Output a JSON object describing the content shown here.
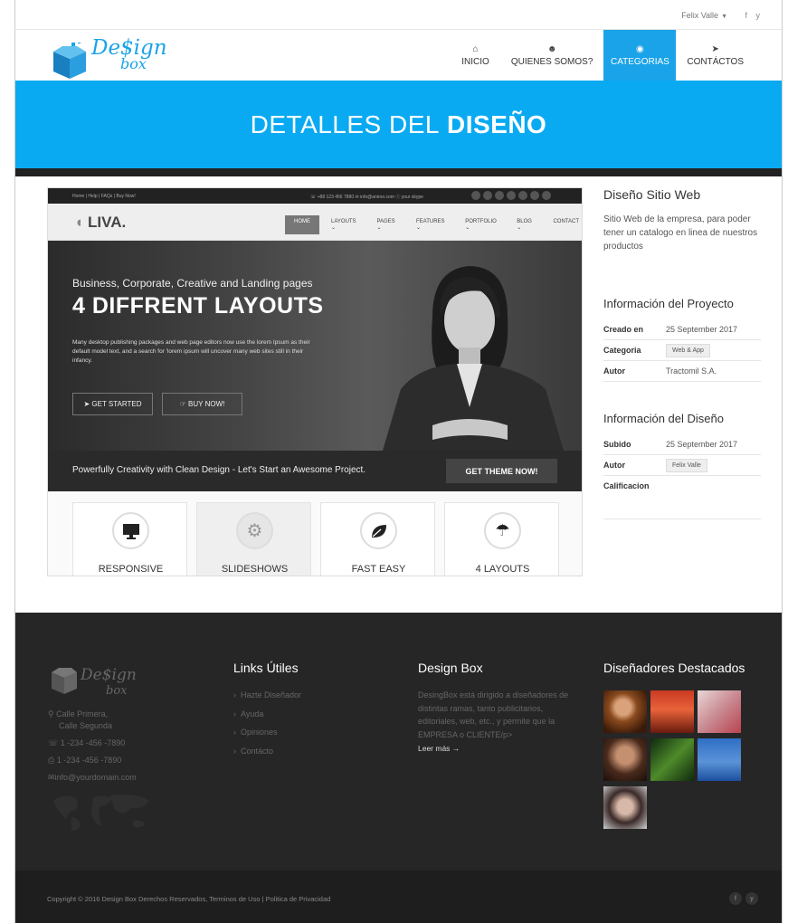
{
  "topbar": {
    "user": "Felix Valle",
    "facebook_icon": "f",
    "twitter_icon": "y"
  },
  "logo": {
    "line1": "De$ign",
    "line2": "box"
  },
  "nav": [
    {
      "label": "INICIO",
      "icon": "⌂",
      "icon_name": "home-icon",
      "active": false
    },
    {
      "label": "QUIENES SOMOS?",
      "icon": "☻",
      "icon_name": "users-icon",
      "active": false
    },
    {
      "label": "CATEGORIAS",
      "icon": "◉",
      "icon_name": "globe-icon",
      "active": true
    },
    {
      "label": "CONTÁCTOS",
      "icon": "➤",
      "icon_name": "send-icon",
      "active": false
    }
  ],
  "banner": {
    "light": "DETALLES DEL",
    "bold": "DISEÑO"
  },
  "mockup": {
    "top_left": "Home | Help | FAQs | Buy Now!",
    "top_right": "☏ +88 123 456 7890    ✉ info@aniroo.com    ⓢ your skype",
    "logo": "LIVA.",
    "nav": [
      "HOME",
      "LAYOUTS ⌄",
      "PAGES ⌄",
      "FEATURES ⌄",
      "PORTFOLIO ⌄",
      "BLOG ⌄",
      "CONTACT"
    ],
    "hero_pre": "Business, Corporate, Creative and Landing pages",
    "hero_title": "4 DIFFRENT LAYOUTS",
    "hero_text": "Many desktop publishing packages and web page editors now use the lorem Ipsum as their default model text, and a search for 'lorem ipsum will uncover many web sites still in their infancy.",
    "btn_start": "GET STARTED",
    "btn_buy": "BUY NOW!",
    "strip_text": "Powerfully Creativity with Clean Design - Let's Start an Awesome Project.",
    "strip_btn": "GET THEME NOW!",
    "features": [
      "RESPONSIVE",
      "SLIDESHOWS",
      "FAST EASY",
      "4 LAYOUTS"
    ]
  },
  "side": {
    "title": "Diseño Sitio Web",
    "desc": "Sitio Web de la empresa, para poder tener un catalogo en linea de nuestros productos",
    "proj_title": "Información del Proyecto",
    "proj": [
      {
        "k": "Creado en",
        "v": "25 September 2017",
        "tag": false
      },
      {
        "k": "Categoria",
        "v": "Web & App",
        "tag": true
      },
      {
        "k": "Autor",
        "v": "Tractomil S.A.",
        "tag": false
      }
    ],
    "design_title": "Información del Diseño",
    "design": [
      {
        "k": "Subido",
        "v": "25 September 2017",
        "tag": false
      },
      {
        "k": "Autor",
        "v": "Felix Valle",
        "tag": true
      },
      {
        "k": "Calificacion",
        "v": "",
        "tag": false
      }
    ]
  },
  "footer": {
    "address1": "Calle Primera,",
    "address2": "Calle Segunda",
    "phone": "1 -234 -456 -7890",
    "fax": "1 -234 -456 -7890",
    "email": "info@yourdomain.com",
    "links_title": "Links Útiles",
    "links": [
      "Hazte Diseñador",
      "Ayuda",
      "Opiniones",
      "Contácto"
    ],
    "db_title": "Design Box",
    "db_text": "DesingBox está dirigido a diseñadores de distintas ramas, tanto publicitarios, editoriales, web, etc., y permite que la EMPRESA o CLIENTE/p>",
    "db_more": "Leer más →",
    "dd_title": "Diseñadores Destacados",
    "copyright": "Copyright © 2016 Design Box Derechos Reservados, Terminos de Uso | Politica de Privacidad"
  }
}
